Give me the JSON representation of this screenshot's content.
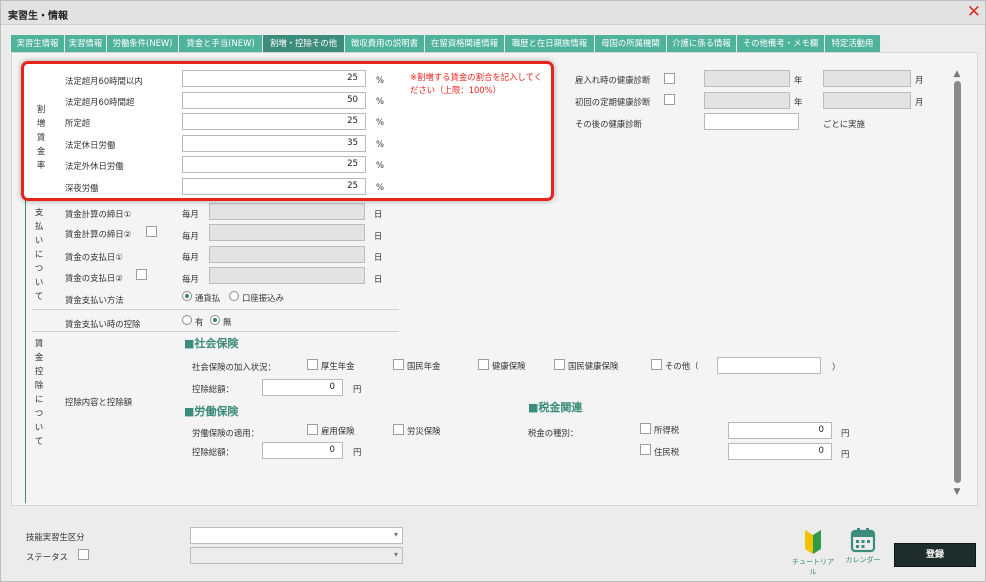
{
  "window": {
    "title": "実習生・情報"
  },
  "tabs": [
    "実習生情報",
    "実習情報",
    "労働条件(NEW)",
    "賃金と手当(NEW)",
    "割増・控除その他",
    "徴収費用の説明書",
    "在留資格関連情報",
    "職歴と在日親族情報",
    "母国の所属機関",
    "介護に係る情報",
    "その他備考・メモ欄",
    "特定活動用"
  ],
  "popup": {
    "side_label": "割増賃金率",
    "rows": [
      {
        "label": "法定超月60時間以内",
        "value": "25",
        "unit": "%"
      },
      {
        "label": "法定超月60時間超",
        "value": "50",
        "unit": "%"
      },
      {
        "label": "所定超",
        "value": "25",
        "unit": "%"
      },
      {
        "label": "法定休日労働",
        "value": "35",
        "unit": "%"
      },
      {
        "label": "法定外休日労働",
        "value": "25",
        "unit": "%"
      },
      {
        "label": "深夜労働",
        "value": "25",
        "unit": "%"
      }
    ],
    "note": "※割増する賃金の割合を記入してください（上限：100%）"
  },
  "health": {
    "rows": [
      {
        "label": "雇入れ時の健康診断",
        "year_unit": "年",
        "month_unit": "月"
      },
      {
        "label": "初回の定期健康診断",
        "year_unit": "年",
        "month_unit": "月"
      },
      {
        "label": "その後の健康診断",
        "suffix": "ごとに実施"
      }
    ]
  },
  "payment": {
    "side_label": "支払いについて",
    "rows": [
      {
        "label": "賃金計算の締日①",
        "prefix": "毎月",
        "suffix": "日"
      },
      {
        "label": "賃金計算の締日②",
        "prefix": "毎月",
        "suffix": "日"
      },
      {
        "label": "賃金の支払日①",
        "prefix": "毎月",
        "suffix": "日"
      },
      {
        "label": "賃金の支払日②",
        "prefix": "毎月",
        "suffix": "日"
      }
    ],
    "method_label": "賃金支払い方法",
    "method_options": [
      "通貨払",
      "口座振込み"
    ],
    "deduction_label": "賃金支払い時の控除",
    "deduction_options": [
      "有",
      "無"
    ]
  },
  "deduction": {
    "side_label": "賃金控除について",
    "items_label": "控除内容と控除額",
    "social": {
      "title": "社会保険",
      "join_label": "社会保険の加入状況：",
      "options": [
        "厚生年金",
        "国民年金",
        "健康保険",
        "国民健康保険",
        "その他（"
      ],
      "close_paren": "）",
      "total_label": "控除総額：",
      "total_value": "0",
      "unit": "円"
    },
    "labor": {
      "title": "労働保険",
      "apply_label": "労働保険の適用：",
      "options": [
        "雇用保険",
        "労災保険"
      ],
      "total_label": "控除総額：",
      "total_value": "0",
      "unit": "円"
    },
    "tax": {
      "title": "税金関連",
      "type_label": "税金の種別：",
      "items": [
        {
          "label": "所得税",
          "value": "0",
          "unit": "円"
        },
        {
          "label": "住民税",
          "value": "0",
          "unit": "円"
        }
      ]
    }
  },
  "footer": {
    "skill_label": "技能実習生区分",
    "status_label": "ステータス",
    "tutorial_label": "チュートリアル",
    "calendar_label": "カレンダー",
    "register_label": "登録"
  }
}
